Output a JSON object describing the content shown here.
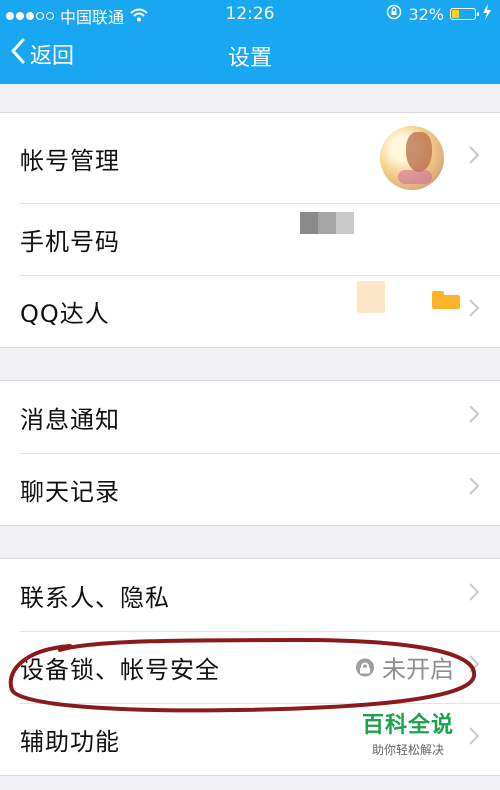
{
  "status_bar": {
    "carrier": "中国联通",
    "time": "12:26",
    "battery_percent": "32%",
    "battery_level": 0.32
  },
  "nav": {
    "back_label": "返回",
    "title": "设置"
  },
  "sections": {
    "account": {
      "items": [
        {
          "label": "帐号管理"
        },
        {
          "label": "手机号码"
        },
        {
          "label": "QQ达人"
        }
      ]
    },
    "messages": {
      "items": [
        {
          "label": "消息通知"
        },
        {
          "label": "聊天记录"
        }
      ]
    },
    "privacy": {
      "items": [
        {
          "label": "联系人、隐私"
        },
        {
          "label": "设备锁、帐号安全",
          "value": "未开启"
        },
        {
          "label": "辅助功能"
        }
      ]
    }
  },
  "watermark": {
    "title": "百科全说",
    "subtitle": "助你轻松解决"
  },
  "colors": {
    "nav_bg": "#1aa7f2",
    "annotation": "#8b1a1a",
    "watermark_green": "#1aa34a"
  }
}
